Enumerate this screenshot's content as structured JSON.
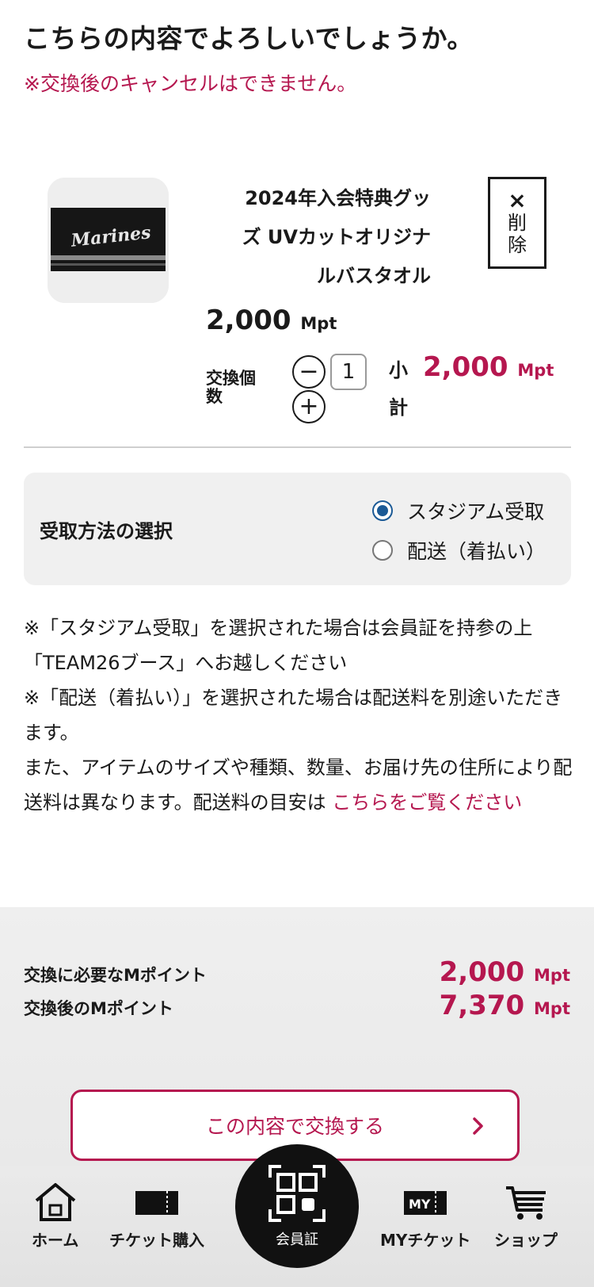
{
  "page": {
    "heading": "こちらの内容でよろしいでしょうか。",
    "warning": "※交換後のキャンセルはできません。"
  },
  "product": {
    "image_text": "Marines",
    "name_lines": [
      "2024年入会特典グッ",
      "ズ UVカットオリジナ",
      "ルバスタオル"
    ],
    "delete_x": "×",
    "delete_label_1": "削",
    "delete_label_2": "除",
    "price": "2,000",
    "price_unit": "Mpt",
    "qty_label": "交換個数",
    "qty_value": "1",
    "minus": "−",
    "plus": "+",
    "subtotal_label": "小計",
    "subtotal": "2,000",
    "subtotal_unit": "Mpt"
  },
  "receive": {
    "title": "受取方法の選択",
    "options": [
      {
        "label": "スタジアム受取",
        "selected": true
      },
      {
        "label": "配送（着払い）",
        "selected": false
      }
    ]
  },
  "notes": {
    "line1": "※「スタジアム受取」を選択された場合は会員証を持参の上「TEAM26ブース」へお越しください",
    "line2": "※「配送（着払い）」を選択された場合は配送料を別途いただきます。",
    "line3_text": "また、アイテムのサイズや種類、数量、お届け先の住所により配送料は異なります。配送料の目安は",
    "line3_link": "こちらをご覧ください"
  },
  "summary": {
    "required_label": "交換に必要なMポイント",
    "required_value": "2,000",
    "after_label": "交換後のMポイント",
    "after_value": "7,370",
    "unit": "Mpt"
  },
  "cta": {
    "label": "この内容で交換する"
  },
  "nav": {
    "home": "ホーム",
    "ticket": "チケット購入",
    "member": "会員証",
    "myticket": "MYチケット",
    "shop": "ショップ",
    "myticket_icon_text": "MY"
  },
  "colors": {
    "accent": "#b5174f",
    "radio": "#1b5a96"
  }
}
